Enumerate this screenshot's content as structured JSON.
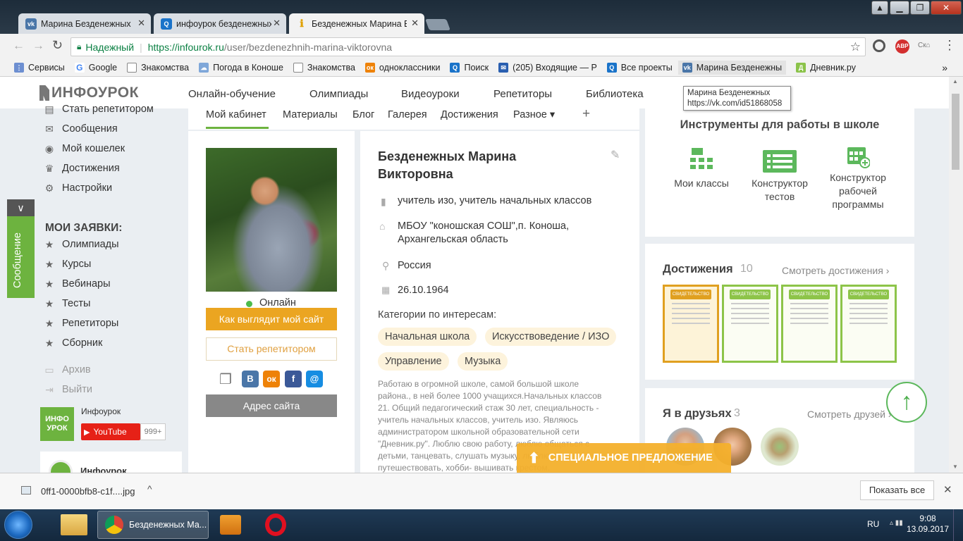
{
  "browser": {
    "tabs": [
      {
        "title": "Марина Безденежных",
        "icon": "vk-icon"
      },
      {
        "title": "инфоурок безденежных",
        "icon": "search-icon"
      },
      {
        "title": "Безденежных Марина В",
        "icon": "infourok-icon"
      }
    ],
    "secure_label": "Надежный",
    "url_host": "https://infourok.ru",
    "url_path": "/user/bezdenezhnih-marina-viktorovna",
    "bookmarks": [
      {
        "label": "Сервисы",
        "icon": "apps-icon"
      },
      {
        "label": "Google",
        "icon": "google-icon"
      },
      {
        "label": "Знакомства",
        "icon": "page-icon"
      },
      {
        "label": "Погода в Коноше",
        "icon": "weather-icon"
      },
      {
        "label": "Знакомства",
        "icon": "page-icon"
      },
      {
        "label": "одноклассники",
        "icon": "ok-icon"
      },
      {
        "label": "Поиск",
        "icon": "search-icon"
      },
      {
        "label": "(205) Входящие — Р",
        "icon": "mail-icon"
      },
      {
        "label": "Все проекты",
        "icon": "search-icon"
      },
      {
        "label": "Марина Безденежны",
        "icon": "vk-icon"
      },
      {
        "label": "Дневник.ру",
        "icon": "dnevnik-icon"
      }
    ]
  },
  "site": {
    "logo": "ИНФОУРОК",
    "nav": [
      "Онлайн-обучение",
      "Олимпиады",
      "Видеоуроки",
      "Репетиторы",
      "Библиотека"
    ],
    "tooltip": {
      "title": "Марина Безденежных",
      "url": "https://vk.com/id51868058"
    }
  },
  "sidebar": {
    "items_top": [
      "Стать репетитором",
      "Сообщения",
      "Мой кошелек",
      "Достижения",
      "Настройки"
    ],
    "section_title": "МОИ ЗАЯВКИ:",
    "items_requests": [
      "Олимпиады",
      "Курсы",
      "Вебинары",
      "Тесты",
      "Репетиторы",
      "Сборник"
    ],
    "items_bottom": [
      "Архив",
      "Выйти"
    ],
    "message_tab": "Сообщение",
    "promo_title": "Инфоурок",
    "youtube_label": "YouTube",
    "youtube_count": "999+",
    "promo_card_title": "Инфоурок",
    "logo_small_1": "ИНФО",
    "logo_small_2": "УРОК"
  },
  "profile_tabs": [
    "Мой кабинет",
    "Материалы",
    "Блог",
    "Галерея",
    "Достижения",
    "Разное ▾",
    "+"
  ],
  "profile": {
    "status": "Онлайн",
    "site_button": "Как выглядит мой сайт",
    "tutor_button": "Стать репетитором",
    "address_button": "Адрес сайта",
    "name": "Безденежных Марина Викторовна",
    "position": "учитель изо, учитель начальных классов",
    "school": "МБОУ \"коношская СОШ\",п. Коноша, Архангельская область",
    "country": "Россия",
    "birthdate": "26.10.1964",
    "interests_title": "Категории по интересам:",
    "interests": [
      "Начальная школа",
      "Искусствоведение / ИЗО",
      "Управление",
      "Музыка"
    ],
    "about": "Работаю в огромной школе, самой большой школе района., в ней более 1000 учащихся.Начальных классов 21. Общий педагогический стаж 30 лет, специальность - учитель начальных классов, учитель изо. Являюсь администратором школьной образовательной сети \"Дневник.ру\". Люблю свою работу, люблю общаться с детьми, танцевать, слушать музыку, люблю путешествовать, хобби- вышивать крестом.",
    "share_icons": [
      "copy-icon",
      "vk-share-icon",
      "ok-share-icon",
      "facebook-share-icon",
      "email-share-icon"
    ]
  },
  "tools": {
    "title": "Инструменты для работы в школе",
    "items": [
      "Мои классы",
      "Конструктор тестов",
      "Конструктор рабочей программы"
    ]
  },
  "achievements": {
    "title": "Достижения",
    "count": "10",
    "link": "Смотреть достижения ›",
    "certificate_label": "СВИДЕТЕЛЬСТВО"
  },
  "friends": {
    "title": "Я в друзьях",
    "count": "3",
    "link": "Смотреть друзей ›"
  },
  "special_offer": "СПЕЦИАЛЬНОЕ ПРЕДЛОЖЕНИЕ",
  "downloads": {
    "file": "0ff1-0000bfb8-c1f....jpg",
    "show_all": "Показать все"
  },
  "taskbar": {
    "chrome_label": "Безденежных Ма...",
    "language": "RU",
    "time": "9:08",
    "date": "13.09.2017"
  },
  "colors": {
    "accent_orange": "#eba521",
    "green": "#72b43a",
    "link_green": "#2e9c4a"
  }
}
